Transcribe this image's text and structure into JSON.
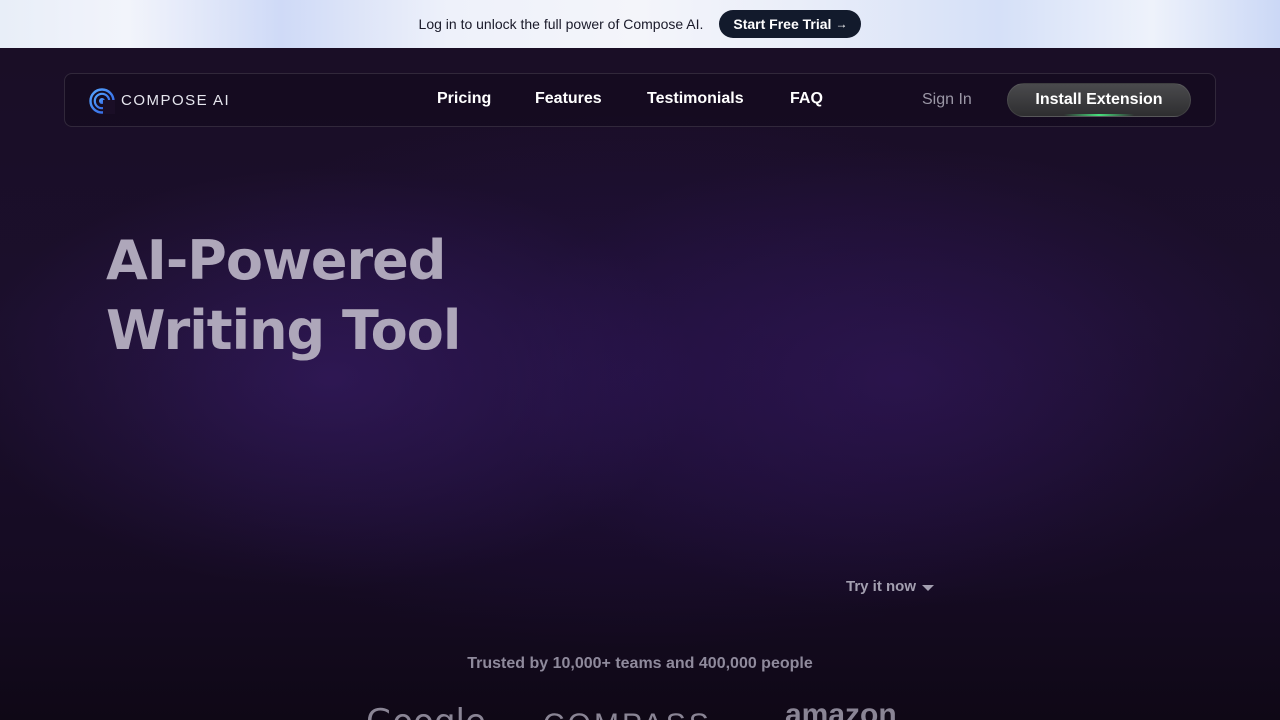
{
  "promo": {
    "text": "Log in to unlock the full power of Compose AI.",
    "cta_label": "Start Free Trial",
    "cta_arrow": "→"
  },
  "nav": {
    "logo_text": "COMPOSE AI",
    "links": [
      "Pricing",
      "Features",
      "Testimonials",
      "FAQ"
    ],
    "sign_in": "Sign In",
    "install": "Install Extension"
  },
  "hero": {
    "title_line1": "AI-Powered",
    "title_line2": "Writing Tool",
    "try_now": "Try it now"
  },
  "social_proof": {
    "trusted_text": "Trusted by 10,000+ teams and 400,000 people",
    "brands": [
      "Google",
      "COMPASS",
      "amazon"
    ]
  },
  "colors": {
    "accent_green": "#47e07d",
    "brand_blue": "#3b7bf0"
  }
}
